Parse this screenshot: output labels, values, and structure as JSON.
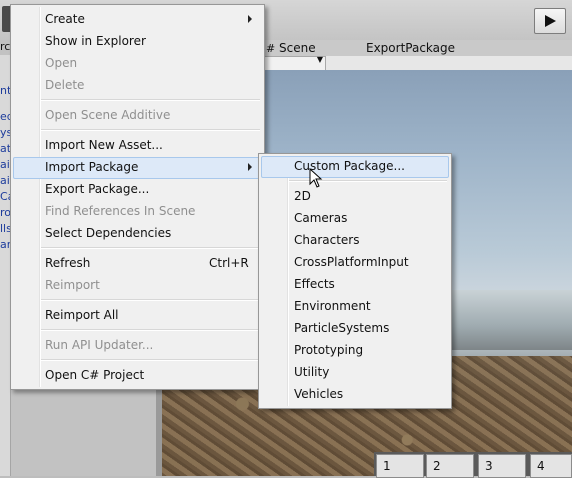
{
  "editor": {
    "tabs": {
      "scene": "Scene",
      "export_package": "ExportPackage"
    },
    "scene_tab_icon": "grid-icon",
    "layer_buttons": [
      "1",
      "2",
      "3",
      "4"
    ],
    "play_icon": "play-icon",
    "hierarchy_fragments": [
      "ed",
      "ys",
      "ata",
      "ai",
      "ai",
      "Ca",
      "ro",
      "lls",
      "ar",
      "pf"
    ],
    "left_fragments": {
      "top": "rch",
      "second": "ntr"
    }
  },
  "context_menu": {
    "items": [
      {
        "label": "Create",
        "enabled": true,
        "submenu": true
      },
      {
        "label": "Show in Explorer",
        "enabled": true
      },
      {
        "label": "Open",
        "enabled": false
      },
      {
        "label": "Delete",
        "enabled": false
      },
      {
        "label": "Open Scene Additive",
        "enabled": false
      },
      {
        "label": "Import New Asset...",
        "enabled": true
      },
      {
        "label": "Import Package",
        "enabled": true,
        "submenu": true,
        "highlighted": true
      },
      {
        "label": "Export Package...",
        "enabled": true
      },
      {
        "label": "Find References In Scene",
        "enabled": false
      },
      {
        "label": "Select Dependencies",
        "enabled": true
      },
      {
        "label": "Refresh",
        "enabled": true,
        "shortcut": "Ctrl+R"
      },
      {
        "label": "Reimport",
        "enabled": false
      },
      {
        "label": "Reimport All",
        "enabled": true
      },
      {
        "label": "Run API Updater...",
        "enabled": false
      },
      {
        "label": "Open C# Project",
        "enabled": true
      }
    ]
  },
  "import_package_submenu": {
    "items": [
      {
        "label": "Custom Package...",
        "highlighted": true
      },
      {
        "label": "2D"
      },
      {
        "label": "Cameras"
      },
      {
        "label": "Characters"
      },
      {
        "label": "CrossPlatformInput"
      },
      {
        "label": "Effects"
      },
      {
        "label": "Environment"
      },
      {
        "label": "ParticleSystems"
      },
      {
        "label": "Prototyping"
      },
      {
        "label": "Utility"
      },
      {
        "label": "Vehicles"
      }
    ]
  },
  "colors": {
    "menu_background": "#f0f0f0",
    "highlight": "#dde9f8",
    "disabled_text": "#8f8f8f"
  }
}
